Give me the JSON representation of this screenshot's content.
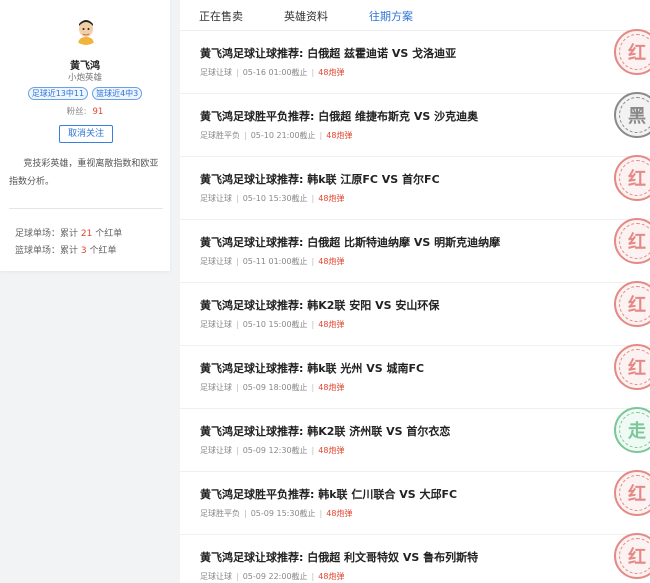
{
  "profile": {
    "name": "黄飞鸿",
    "title": "小炮英雄",
    "tags": [
      "足球近13中11",
      "篮球近4中3"
    ],
    "fans_label": "粉丝:",
    "fans_count": "91",
    "follow_button": "取消关注",
    "description": "竞技彩英雄，重视离散指数和欧亚指数分析。",
    "football_record": {
      "prefix": "足球单场：累计",
      "count": "21",
      "suffix": "个红单"
    },
    "basketball_record": {
      "prefix": "篮球单场：累计",
      "count": "3",
      "suffix": "个红单"
    }
  },
  "tabs": [
    "正在售卖",
    "英雄资料",
    "往期方案"
  ],
  "active_tab": "往期方案",
  "items": [
    {
      "title": "黄飞鸿足球让球推荐: 白俄超 兹霍迪诺 VS 戈洛迪亚",
      "type": "足球让球",
      "deadline": "05-16 01:00截止",
      "price": "48炮弹",
      "result": "红",
      "result_color": "red"
    },
    {
      "title": "黄飞鸿足球胜平负推荐: 白俄超 维捷布斯克 VS 沙克迪奥",
      "type": "足球胜平负",
      "deadline": "05-10 21:00截止",
      "price": "48炮弹",
      "result": "黑",
      "result_color": "black"
    },
    {
      "title": "黄飞鸿足球让球推荐: 韩k联 江原FC VS 首尔FC",
      "type": "足球让球",
      "deadline": "05-10 15:30截止",
      "price": "48炮弹",
      "result": "红",
      "result_color": "red"
    },
    {
      "title": "黄飞鸿足球让球推荐: 白俄超 比斯特迪纳摩 VS 明斯克迪纳摩",
      "type": "足球让球",
      "deadline": "05-11 01:00截止",
      "price": "48炮弹",
      "result": "红",
      "result_color": "red"
    },
    {
      "title": "黄飞鸿足球让球推荐: 韩K2联 安阳 VS 安山环保",
      "type": "足球让球",
      "deadline": "05-10 15:00截止",
      "price": "48炮弹",
      "result": "红",
      "result_color": "red"
    },
    {
      "title": "黄飞鸿足球让球推荐: 韩k联 光州 VS 城南FC",
      "type": "足球让球",
      "deadline": "05-09 18:00截止",
      "price": "48炮弹",
      "result": "红",
      "result_color": "red"
    },
    {
      "title": "黄飞鸿足球让球推荐: 韩K2联 济州联 VS 首尔衣恋",
      "type": "足球让球",
      "deadline": "05-09 12:30截止",
      "price": "48炮弹",
      "result": "走",
      "result_color": "green"
    },
    {
      "title": "黄飞鸿足球胜平负推荐: 韩k联 仁川联合 VS 大邱FC",
      "type": "足球胜平负",
      "deadline": "05-09 15:30截止",
      "price": "48炮弹",
      "result": "红",
      "result_color": "red"
    },
    {
      "title": "黄飞鸿足球让球推荐: 白俄超 利文哥特奴 VS 鲁布列斯特",
      "type": "足球让球",
      "deadline": "05-09 22:00截止",
      "price": "48炮弹",
      "result": "红",
      "result_color": "red"
    }
  ]
}
